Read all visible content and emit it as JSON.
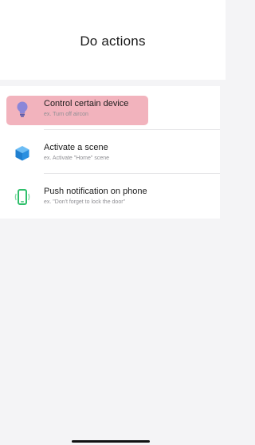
{
  "header": {
    "title": "Do actions"
  },
  "actions": [
    {
      "icon": "lightbulb-icon",
      "label": "Control certain device",
      "example": "ex. Turn off aircon",
      "highlighted": true
    },
    {
      "icon": "cube-icon",
      "label": "Activate a scene",
      "example": "ex. Activate \"Home\" scene",
      "highlighted": false
    },
    {
      "icon": "phone-notification-icon",
      "label": "Push notification on phone",
      "example": "ex. \"Don't forget to lock the door\"",
      "highlighted": false
    }
  ],
  "colors": {
    "highlight": "#f2b3bd",
    "bulb": "#8b86d8",
    "cube": "#2a8fe0",
    "phone": "#2fbf6b"
  }
}
